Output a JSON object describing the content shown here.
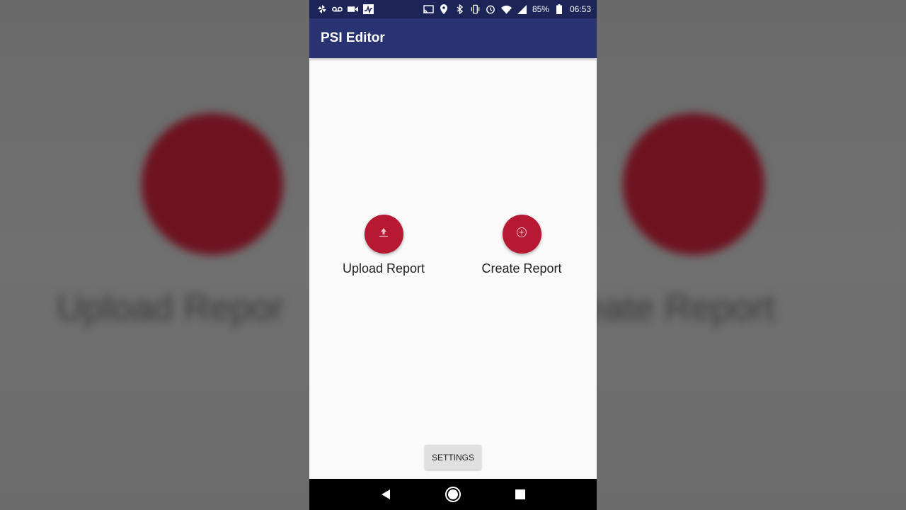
{
  "background": {
    "blurred_left_text": "Upload Repor",
    "blurred_right_text": "eate Report"
  },
  "status_bar": {
    "battery": "85%",
    "time": "06:53",
    "left_icons": [
      "pinwheel-icon",
      "voicemail-icon",
      "video-camera-icon",
      "activity-icon"
    ],
    "right_icons": [
      "cast-icon",
      "location-icon",
      "bluetooth-icon",
      "vibrate-icon",
      "alarm-icon",
      "wifi-icon",
      "signal-icon",
      "battery-icon"
    ]
  },
  "app_bar": {
    "title": "PSI Editor"
  },
  "actions": {
    "upload": {
      "label": "Upload Report",
      "icon": "upload-icon"
    },
    "create": {
      "label": "Create Report",
      "icon": "add-circle-icon"
    }
  },
  "settings": {
    "label": "SETTINGS"
  },
  "nav_bar": {
    "buttons": [
      "back-icon",
      "home-icon",
      "recents-icon"
    ]
  },
  "colors": {
    "status_bar": "#1d2457",
    "app_bar": "#293372",
    "accent": "#b71933",
    "content_bg": "#fafafa"
  }
}
